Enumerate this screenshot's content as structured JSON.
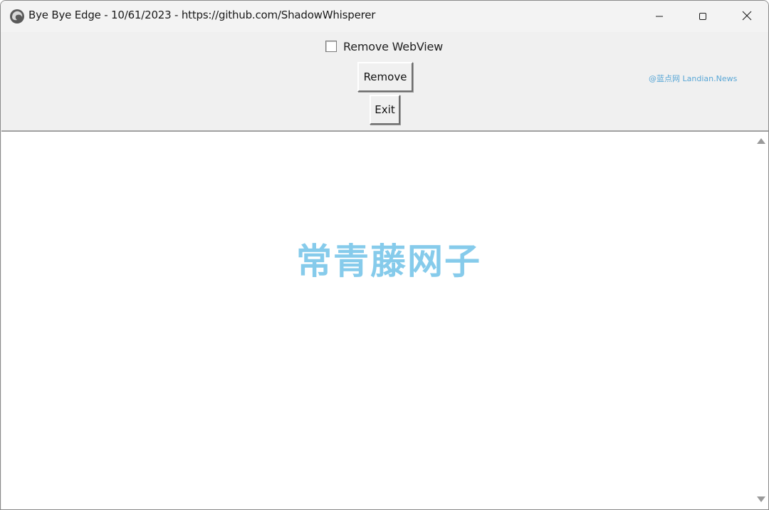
{
  "window": {
    "title": "Bye Bye Edge - 10/61/2023 - https://github.com/ShadowWhisperer"
  },
  "controls": {
    "checkbox_label": "Remove WebView",
    "checkbox_checked": false,
    "remove_button_label": "Remove",
    "exit_button_label": "Exit"
  },
  "watermarks": {
    "small": "@蓝点网 Landian.News",
    "large": "常青藤网子"
  },
  "icons": {
    "app": "edge-logo-icon",
    "minimize": "minimize-icon",
    "maximize": "maximize-icon",
    "close": "close-icon",
    "scroll_up": "scroll-up-arrow-icon",
    "scroll_down": "scroll-down-arrow-icon"
  },
  "colors": {
    "watermark": "#7cc7ea",
    "window_bg": "#f0f0f0"
  }
}
